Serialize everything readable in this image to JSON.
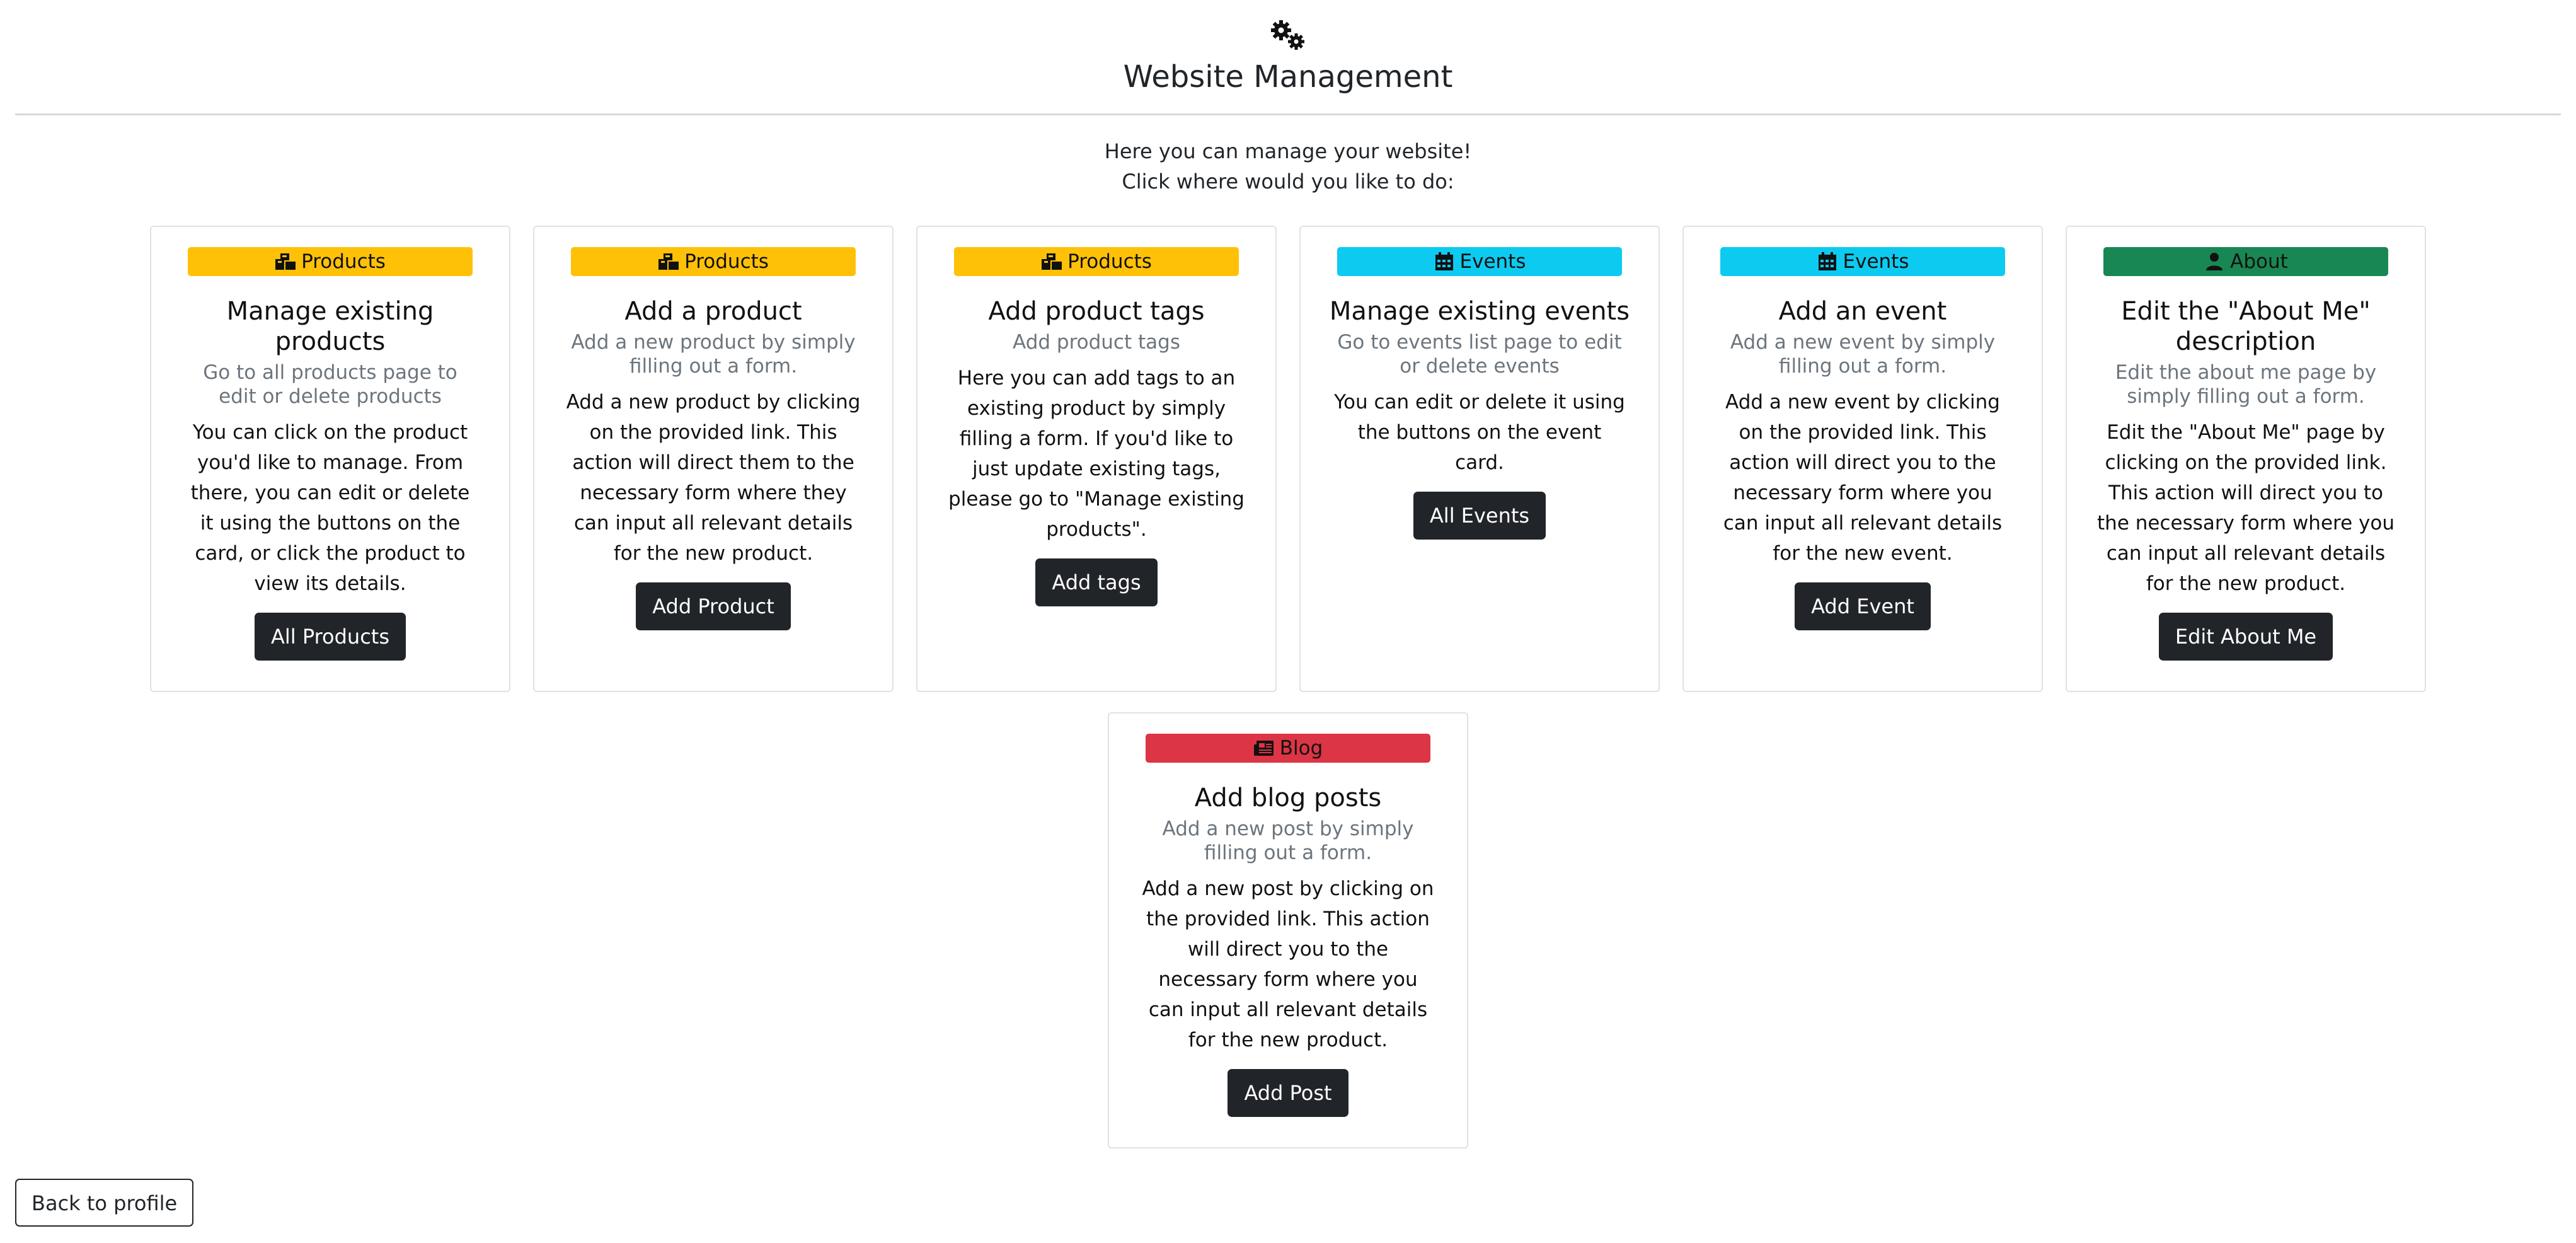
{
  "header": {
    "title": "Website Management",
    "icon": "gears-icon"
  },
  "intro": {
    "line1": "Here you can manage your website!",
    "line2": "Click where would you like to do:"
  },
  "cards": [
    {
      "badge": "Products",
      "badge_icon": "boxes-icon",
      "badge_color": "#ffc107",
      "title": "Manage existing products",
      "subtitle": "Go to all products page to edit or delete products",
      "text": "You can click on the product you'd like to manage. From there, you can edit or delete it using the buttons on the card, or click the product to view its details.",
      "button": "All Products"
    },
    {
      "badge": "Products",
      "badge_icon": "boxes-icon",
      "badge_color": "#ffc107",
      "title": "Add a product",
      "subtitle": "Add a new product by simply filling out a form.",
      "text": "Add a new product by clicking on the provided link. This action will direct them to the necessary form where they can input all relevant details for the new product.",
      "button": "Add Product"
    },
    {
      "badge": "Products",
      "badge_icon": "boxes-icon",
      "badge_color": "#ffc107",
      "title": "Add product tags",
      "subtitle": "Add product tags",
      "text": "Here you can add tags to an existing product by simply filling a form. If you'd like to just update existing tags, please go to \"Manage existing products\".",
      "button": "Add tags"
    },
    {
      "badge": "Events",
      "badge_icon": "calendar-icon",
      "badge_color": "#0dcaf0",
      "title": "Manage existing events",
      "subtitle": "Go to events list page to edit or delete events",
      "text": "You can edit or delete it using the buttons on the event card.",
      "button": "All Events"
    },
    {
      "badge": "Events",
      "badge_icon": "calendar-icon",
      "badge_color": "#0dcaf0",
      "title": "Add an event",
      "subtitle": "Add a new event by simply filling out a form.",
      "text": "Add a new event by clicking on the provided link. This action will direct you to the necessary form where you can input all relevant details for the new event.",
      "button": "Add Event"
    },
    {
      "badge": "About",
      "badge_icon": "user-icon",
      "badge_color": "#198754",
      "title": "Edit the \"About Me\" description",
      "subtitle": "Edit the about me page by simply filling out a form.",
      "text": "Edit the \"About Me\" page by clicking on the provided link. This action will direct you to the necessary form where you can input all relevant details for the new product.",
      "button": "Edit About Me"
    },
    {
      "badge": "Blog",
      "badge_icon": "newspaper-icon",
      "badge_color": "#dc3545",
      "title": "Add blog posts",
      "subtitle": "Add a new post by simply filling out a form.",
      "text": "Add a new post by clicking on the provided link. This action will direct you to the necessary form where you can input all relevant details for the new product.",
      "button": "Add Post"
    }
  ],
  "footer": {
    "back_label": "Back to profile"
  }
}
